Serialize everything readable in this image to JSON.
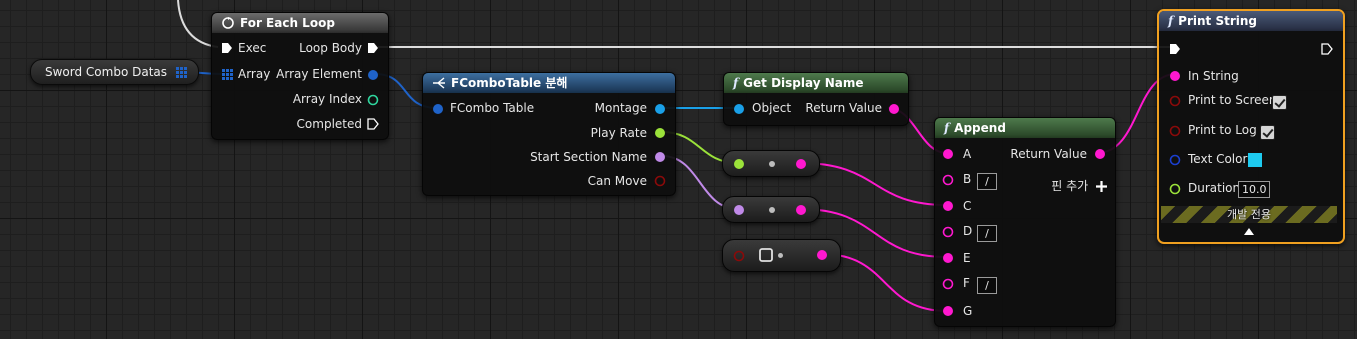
{
  "variable": {
    "label": "Sword Combo Datas"
  },
  "for_each": {
    "title": "For Each Loop",
    "in_exec": "Exec",
    "in_array": "Array",
    "out_loop_body": "Loop Body",
    "out_element": "Array Element",
    "out_index": "Array Index",
    "out_completed": "Completed"
  },
  "break_node": {
    "title": "FComboTable 분해",
    "in_struct": "FCombo Table",
    "out_montage": "Montage",
    "out_play_rate": "Play Rate",
    "out_section": "Start Section Name",
    "out_can_move": "Can Move"
  },
  "display_name": {
    "title": "Get Display Name",
    "in_object": "Object",
    "out_return": "Return Value"
  },
  "append": {
    "title": "Append",
    "pins": [
      "A",
      "B",
      "C",
      "D",
      "E",
      "F",
      "G"
    ],
    "slash": "/",
    "out_return": "Return Value",
    "add_pin": "핀 추가"
  },
  "print_string": {
    "title": "Print String",
    "in_string": "In String",
    "print_screen": "Print to Screen",
    "print_log": "Print to Log",
    "text_color": "Text Color",
    "duration": "Duration",
    "duration_value": "10.0",
    "dev_only": "개발 전용"
  },
  "colors": {
    "exec": "#ffffff",
    "struct": "#1f63c9",
    "object": "#1aa0e8",
    "float": "#9be23a",
    "name": "#c08ae8",
    "bool": "#8b0a0a",
    "string": "#ff18cf",
    "integer": "#2fd69e",
    "linear_color": "#1b3fd0",
    "text_color_swatch": "#1ecbf0",
    "selection": "#f0a020"
  }
}
